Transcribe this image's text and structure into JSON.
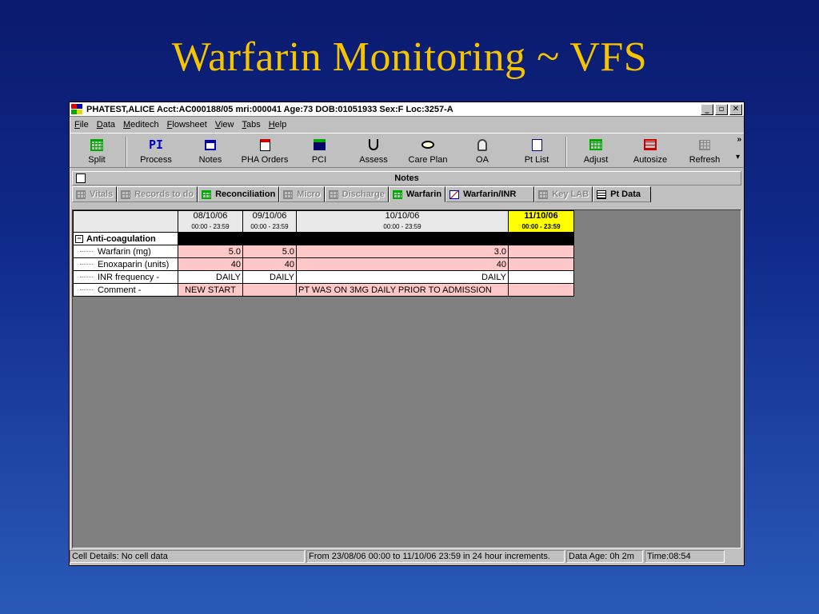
{
  "slide": {
    "title": "Warfarin Monitoring ~ VFS"
  },
  "window": {
    "title": "PHATEST,ALICE Acct:AC000188/05 mri:000041 Age:73 DOB:01051933 Sex:F Loc:3257-A",
    "minimize": "_",
    "restore": "▫",
    "close": "✕"
  },
  "menu": [
    "File",
    "Data",
    "Meditech",
    "Flowsheet",
    "View",
    "Tabs",
    "Help"
  ],
  "toolbar": [
    {
      "label": "Split",
      "icon": "split-grid-icon"
    },
    {
      "label": "Process",
      "icon": "pi-icon",
      "text": "PI"
    },
    {
      "label": "Notes",
      "icon": "notes-icon"
    },
    {
      "label": "PHA Orders",
      "icon": "pha-orders-icon"
    },
    {
      "label": "PCI",
      "icon": "pci-icon"
    },
    {
      "label": "Assess",
      "icon": "stethoscope-icon"
    },
    {
      "label": "Care Plan",
      "icon": "care-plan-icon"
    },
    {
      "label": "OA",
      "icon": "oa-icon"
    },
    {
      "label": "Pt List",
      "icon": "pt-list-icon"
    },
    {
      "label": "Adjust",
      "icon": "adjust-icon"
    },
    {
      "label": "Autosize",
      "icon": "autosize-icon"
    },
    {
      "label": "Refresh",
      "icon": "refresh-icon"
    }
  ],
  "toolbar_more": "»",
  "notes_bar": {
    "label": "Notes"
  },
  "tabs": [
    {
      "label": "Vitals",
      "state": "disabled"
    },
    {
      "label": "Records to do",
      "state": "disabled"
    },
    {
      "label": "Reconciliation",
      "state": "enabled"
    },
    {
      "label": "Micro",
      "state": "disabled"
    },
    {
      "label": "Discharge",
      "state": "disabled"
    },
    {
      "label": "Warfarin",
      "state": "active"
    },
    {
      "label": "Warfarin/INR",
      "state": "enabled"
    },
    {
      "label": "Key LAB",
      "state": "disabled"
    },
    {
      "label": "Pt Data",
      "state": "enabled"
    }
  ],
  "flowsheet": {
    "columns": [
      {
        "date": "08/10/06",
        "range": "00:00 - 23:59"
      },
      {
        "date": "09/10/06",
        "range": "00:00 - 23:59"
      },
      {
        "date": "10/10/06",
        "range": "00:00 - 23:59"
      },
      {
        "date": "11/10/06",
        "range": "00:00 - 23:59",
        "today": true
      }
    ],
    "section": "Anti-coagulation",
    "section_toggle": "−",
    "rows": [
      {
        "label": "Warfarin (mg)",
        "cells": [
          "5.0",
          "5.0",
          "3.0",
          ""
        ]
      },
      {
        "label": "Enoxaparin (units)",
        "cells": [
          "40",
          "40",
          "40",
          ""
        ]
      },
      {
        "label": "INR frequency -",
        "cells": [
          "DAILY",
          "DAILY",
          "DAILY",
          ""
        ]
      },
      {
        "label": "Comment -",
        "cells": [
          "NEW START",
          "",
          "PT WAS ON 3MG DAILY PRIOR TO ADMISSION",
          ""
        ]
      }
    ]
  },
  "status": {
    "cell_details": "Cell Details: No cell data",
    "range": "From 23/08/06 00:00 to 11/10/06 23:59 in 24 hour increments.",
    "data_age": "Data Age: 0h 2m",
    "time": "Time:08:54"
  },
  "colors": {
    "title": "#f5c400",
    "pink_cell": "#ffc8c8",
    "today": "#ffff00"
  }
}
